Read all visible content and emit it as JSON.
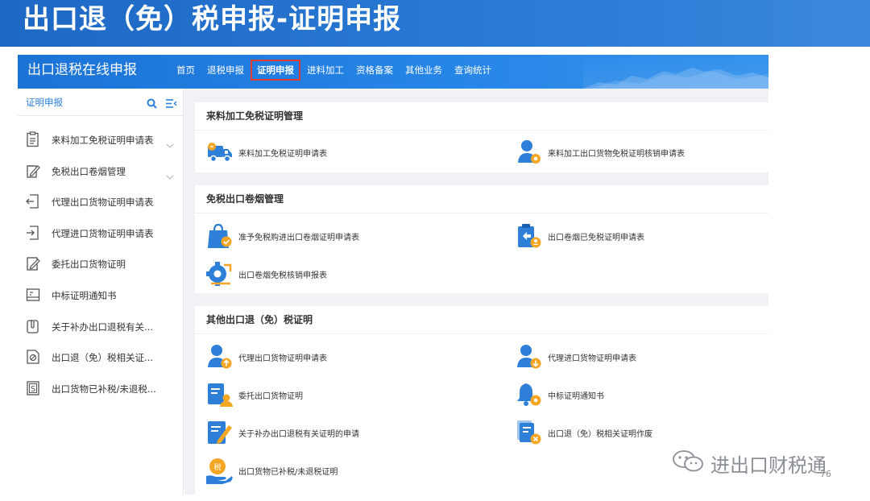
{
  "slide": {
    "title": "出口退（免）税申报-证明申报",
    "page_number": "76"
  },
  "app": {
    "title": "出口退税在线申报",
    "nav": [
      {
        "label": "首页",
        "active": false
      },
      {
        "label": "退税申报",
        "active": false
      },
      {
        "label": "证明申报",
        "active": true
      },
      {
        "label": "进料加工",
        "active": false
      },
      {
        "label": "资格备案",
        "active": false
      },
      {
        "label": "其他业务",
        "active": false
      },
      {
        "label": "查询统计",
        "active": false
      }
    ]
  },
  "sidebar": {
    "title": "证明申报",
    "items": [
      {
        "label": "来料加工免税证明申请表",
        "icon": "clipboard-list-icon",
        "expandable": true
      },
      {
        "label": "免税出口卷烟管理",
        "icon": "edit-pen-icon",
        "expandable": true
      },
      {
        "label": "代理出口货物证明申请表",
        "icon": "export-doc-icon",
        "expandable": false
      },
      {
        "label": "代理进口货物证明申请表",
        "icon": "import-doc-icon",
        "expandable": false
      },
      {
        "label": "委托出口货物证明",
        "icon": "edit-doc-icon",
        "expandable": false
      },
      {
        "label": "中标证明通知书",
        "icon": "notice-board-icon",
        "expandable": false
      },
      {
        "label": "关于补办出口退税有关...",
        "icon": "paperclip-doc-icon",
        "expandable": false
      },
      {
        "label": "出口退（免）税相关证...",
        "icon": "stamp-doc-icon",
        "expandable": false
      },
      {
        "label": "出口货物已补税/未退税...",
        "icon": "s-doc-icon",
        "expandable": false
      }
    ]
  },
  "panels": [
    {
      "title": "来料加工免税证明管理",
      "tiles": [
        {
          "label": "来料加工免税证明申请表",
          "icon": "truck-icon"
        },
        {
          "label": "来料加工出口货物免税证明核销申请表",
          "icon": "user-gear-icon"
        }
      ]
    },
    {
      "title": "免税出口卷烟管理",
      "tiles": [
        {
          "label": "准予免税购进出口卷烟证明申请表",
          "icon": "shopping-bag-check-icon"
        },
        {
          "label": "出口卷烟已免税证明申请表",
          "icon": "clipboard-user-icon"
        },
        {
          "label": "出口卷烟免税核销申报表",
          "icon": "gear-cycle-icon"
        }
      ]
    },
    {
      "title": "其他出口退（免）税证明",
      "tiles": [
        {
          "label": "代理出口货物证明申请表",
          "icon": "user-upload-icon"
        },
        {
          "label": "代理进口货物证明申请表",
          "icon": "user-download-icon"
        },
        {
          "label": "委托出口货物证明",
          "icon": "form-user-icon"
        },
        {
          "label": "中标证明通知书",
          "icon": "bell-gear-icon"
        },
        {
          "label": "关于补办出口退税有关证明的申请",
          "icon": "doc-pen-icon"
        },
        {
          "label": "出口退（免）税相关证明作废",
          "icon": "doc-cancel-icon"
        },
        {
          "label": "出口货物已补税/未退税证明",
          "icon": "tax-hand-icon"
        }
      ]
    }
  ],
  "watermark": {
    "text": "进出口财税通",
    "icon": "wechat-icon"
  },
  "colors": {
    "brand_blue": "#1d6fd1",
    "accent_orange": "#f5a623",
    "active_border": "#e0392d"
  }
}
